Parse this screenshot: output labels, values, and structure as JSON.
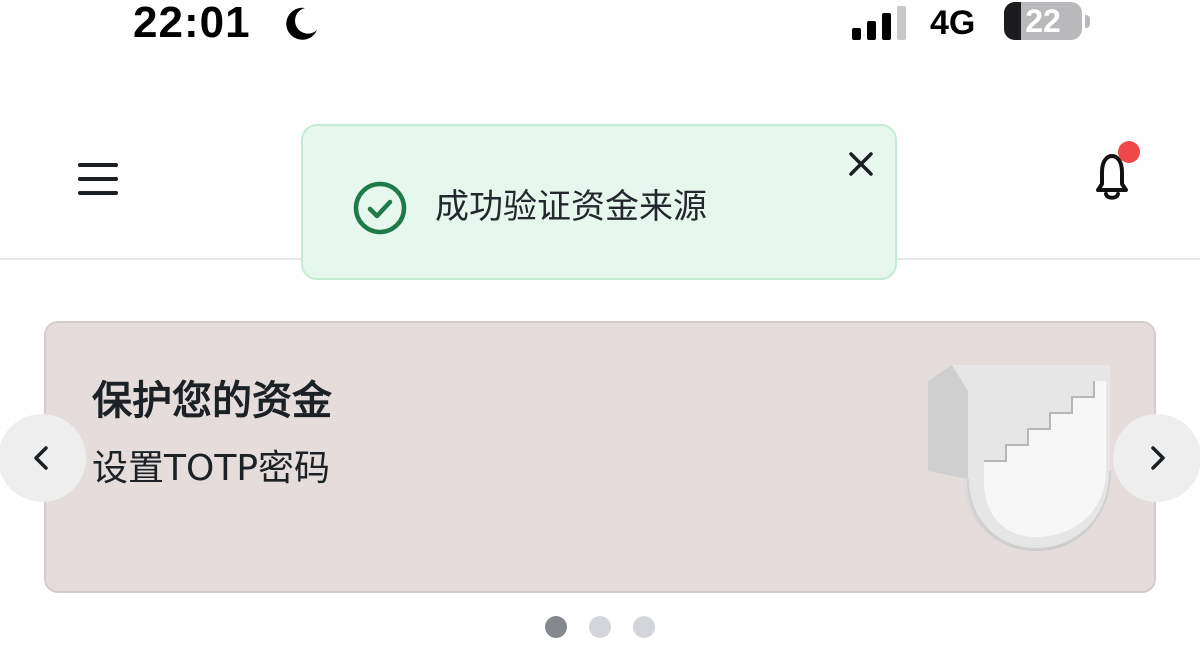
{
  "status_bar": {
    "time": "22:01",
    "network": "4G",
    "battery_level": "22",
    "battery_fraction": 0.22,
    "signal_bars_active": 3,
    "signal_bars_total": 4,
    "icons": {
      "moon": "moon-icon",
      "signal": "cellular-signal-icon",
      "battery": "battery-icon"
    }
  },
  "header": {
    "menu_icon": "hamburger-menu-icon",
    "notification_icon": "bell-icon",
    "has_unread": true
  },
  "toast": {
    "message": "成功验证资金来源",
    "icon": "check-circle-icon",
    "close_icon": "close-icon"
  },
  "banner": {
    "title": "保护您的资金",
    "subtitle": "设置TOTP密码",
    "illustration": "staircase-illustration",
    "prev_icon": "chevron-left-icon",
    "next_icon": "chevron-right-icon"
  },
  "carousel": {
    "total": 3,
    "active_index": 0
  },
  "colors": {
    "toast_bg": "#e6f7ee",
    "toast_border": "#c5ebd5",
    "success_green": "#1e7a46",
    "banner_bg": "#e5dcdc",
    "notification_dot": "#f0474a",
    "dot_active": "#85888d",
    "dot_inactive": "#d4d5da"
  }
}
